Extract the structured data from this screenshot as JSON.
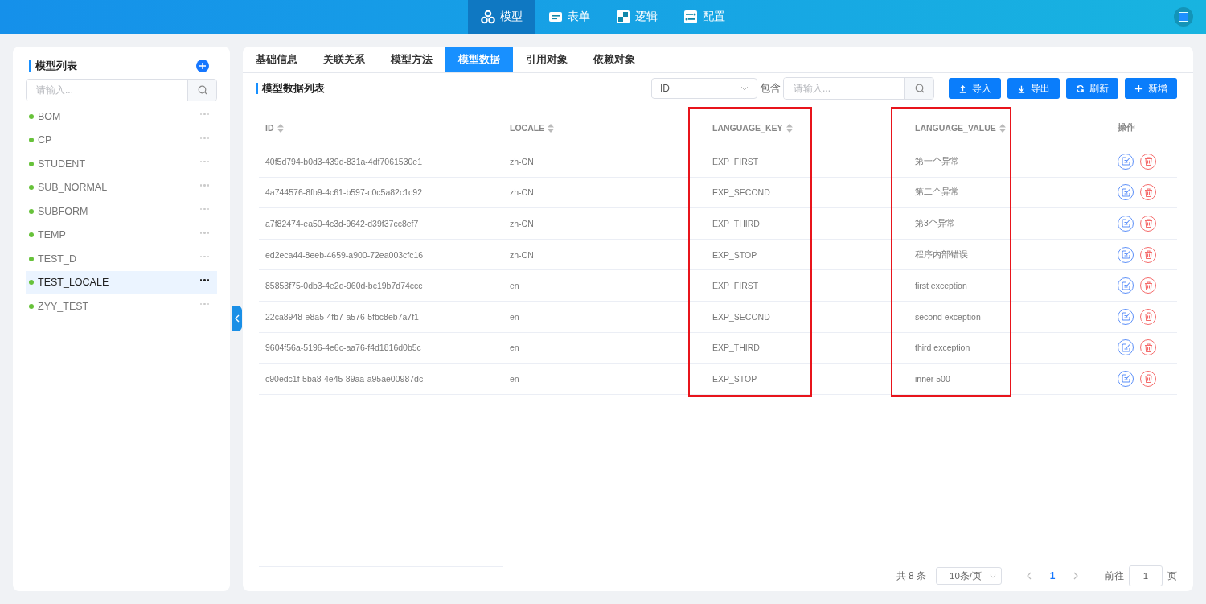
{
  "top_nav": {
    "items": [
      {
        "label": "模型",
        "selected": true
      },
      {
        "label": "表单",
        "selected": false
      },
      {
        "label": "逻辑",
        "selected": false
      },
      {
        "label": "配置",
        "selected": false
      }
    ]
  },
  "sidebar": {
    "title": "模型列表",
    "search": {
      "placeholder": "请输入..."
    },
    "items": [
      {
        "label": "BOM",
        "selected": false
      },
      {
        "label": "CP",
        "selected": false
      },
      {
        "label": "STUDENT",
        "selected": false
      },
      {
        "label": "SUB_NORMAL",
        "selected": false
      },
      {
        "label": "SUBFORM",
        "selected": false
      },
      {
        "label": "TEMP",
        "selected": false
      },
      {
        "label": "TEST_D",
        "selected": false
      },
      {
        "label": "TEST_LOCALE",
        "selected": true
      },
      {
        "label": "ZYY_TEST",
        "selected": false
      }
    ]
  },
  "tabs": [
    {
      "label": "基础信息",
      "selected": false
    },
    {
      "label": "关联关系",
      "selected": false
    },
    {
      "label": "模型方法",
      "selected": false
    },
    {
      "label": "模型数据",
      "selected": true
    },
    {
      "label": "引用对象",
      "selected": false
    },
    {
      "label": "依赖对象",
      "selected": false
    }
  ],
  "section_title": "模型数据列表",
  "filter": {
    "field": "ID",
    "operator": "包含",
    "placeholder": "请输入..."
  },
  "buttons": [
    {
      "label": "导入",
      "kind": "upload"
    },
    {
      "label": "导出",
      "kind": "download"
    },
    {
      "label": "刷新",
      "kind": "refresh"
    },
    {
      "label": "新增",
      "kind": "add"
    }
  ],
  "table": {
    "columns": [
      {
        "label": "ID",
        "sortable": true,
        "highlighted": false
      },
      {
        "label": "LOCALE",
        "sortable": true,
        "highlighted": false
      },
      {
        "label": "LANGUAGE_KEY",
        "sortable": true,
        "highlighted": true
      },
      {
        "label": "LANGUAGE_VALUE",
        "sortable": true,
        "highlighted": true
      },
      {
        "label": "操作",
        "sortable": false,
        "highlighted": false
      }
    ],
    "rows": [
      [
        "40f5d794-b0d3-439d-831a-4df7061530e1",
        "zh-CN",
        "EXP_FIRST",
        "第一个异常"
      ],
      [
        "4a744576-8fb9-4c61-b597-c0c5a82c1c92",
        "zh-CN",
        "EXP_SECOND",
        "第二个异常"
      ],
      [
        "a7f82474-ea50-4c3d-9642-d39f37cc8ef7",
        "zh-CN",
        "EXP_THIRD",
        "第3个异常"
      ],
      [
        "ed2eca44-8eeb-4659-a900-72ea003cfc16",
        "zh-CN",
        "EXP_STOP",
        "程序内部错误"
      ],
      [
        "85853f75-0db3-4e2d-960d-bc19b7d74ccc",
        "en",
        "EXP_FIRST",
        "first exception"
      ],
      [
        "22ca8948-e8a5-4fb7-a576-5fbc8eb7a7f1",
        "en",
        "EXP_SECOND",
        "second exception"
      ],
      [
        "9604f56a-5196-4e6c-aa76-f4d1816d0b5c",
        "en",
        "EXP_THIRD",
        "third exception"
      ],
      [
        "c90edc1f-5ba8-4e45-89aa-a95ae00987dc",
        "en",
        "EXP_STOP",
        "inner 500"
      ]
    ]
  },
  "pagination": {
    "total": "共 8 条",
    "page_size": "10条/页",
    "pages": [
      {
        "label": "1",
        "selected": true
      }
    ],
    "goto_label": "前往",
    "goto_value": "1",
    "goto_suffix": "页"
  }
}
